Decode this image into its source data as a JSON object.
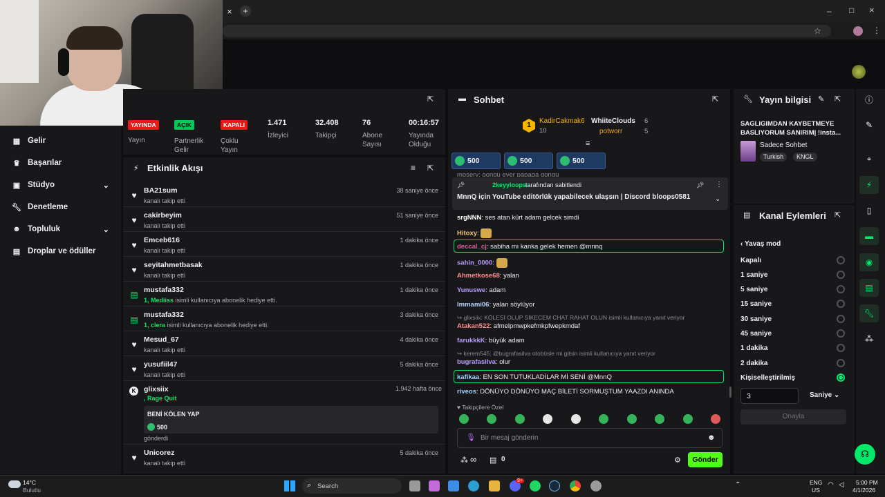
{
  "browser": {
    "tab_close": "×",
    "new_tab": "+",
    "win_min": "–",
    "win_max": "□",
    "win_close": "×"
  },
  "left_nav": {
    "items": [
      {
        "label": "Gelir",
        "icon": "chart-icon"
      },
      {
        "label": "Başarılar",
        "icon": "trophy-icon"
      },
      {
        "label": "Stüdyo",
        "icon": "studio-icon",
        "expandable": true
      },
      {
        "label": "Denetleme",
        "icon": "wrench-icon"
      },
      {
        "label": "Topluluk",
        "icon": "community-icon",
        "expandable": true
      },
      {
        "label": "Droplar ve ödüller",
        "icon": "gift-icon"
      }
    ]
  },
  "stats": {
    "tags": [
      "YAYINDA",
      "AÇIK",
      "KAPALI"
    ],
    "labels": [
      "Yayın",
      "Partnerlik\nGelir",
      "Çoklu\nYayın"
    ],
    "items": [
      {
        "value": "1.471",
        "label": "İzleyici"
      },
      {
        "value": "32.408",
        "label": "Takipçi"
      },
      {
        "value": "76",
        "label": "Abone\nSayısı"
      },
      {
        "value": "00:16:57",
        "label": "Yayında\nOlduğu"
      }
    ]
  },
  "activity": {
    "title": "Etkinlik Akışı",
    "rows": [
      {
        "name": "BA21sum",
        "sub": "kanalı takip etti",
        "time": "38 saniye önce",
        "type": "follow"
      },
      {
        "name": "cakirbeyim",
        "sub": "kanalı takip etti",
        "time": "51 saniye önce",
        "type": "follow"
      },
      {
        "name": "Emceb616",
        "sub": "kanalı takip etti",
        "time": "1 dakika önce",
        "type": "follow"
      },
      {
        "name": "seyitahmetbasak",
        "sub": "kanalı takip etti",
        "time": "1 dakika önce",
        "type": "follow"
      },
      {
        "name": "mustafa332",
        "sub_hl": "1, Mediiss",
        "sub": " isimli kullanıcıya abonelik hediye etti.",
        "time": "1 dakika önce",
        "type": "gift"
      },
      {
        "name": "mustafa332",
        "sub_hl": "1, clera",
        "sub": " isimli kullanıcıya abonelik hediye etti.",
        "time": "3 dakika önce",
        "type": "gift"
      },
      {
        "name": "Mesud_67",
        "sub": "kanalı takip etti",
        "time": "4 dakika önce",
        "type": "follow"
      },
      {
        "name": "yusufiil47",
        "sub": "kanalı takip etti",
        "time": "5 dakika önce",
        "type": "follow"
      }
    ],
    "redeem": {
      "name": "glixsiix",
      "sub_hl": ", Rage Quit",
      "time": "1.942 hafta önce",
      "message": "BENİ KÖLEN YAP",
      "points": "500",
      "footer": "gönderdi"
    },
    "last": {
      "name": "Unicorez",
      "sub": "kanalı takip etti",
      "time": "5 dakika önce"
    }
  },
  "chat": {
    "title": "Sohbet",
    "leaders": [
      {
        "rank": "1",
        "name": "KadirCakmak6",
        "count": "10"
      },
      {
        "name": "WhiiteClouds",
        "count": "6"
      },
      {
        "name": "potworr",
        "count": "5"
      }
    ],
    "points": [
      "500",
      "500",
      "500"
    ],
    "partial": "moserv: gongu eyer papaga gongu",
    "pinned": {
      "by": "2keyyloops",
      "by_suffix": "tarafından sabitlendi",
      "text": "MnnQ için YouTube editörlük yapabilecek ulaşsın | Discord bloops0581"
    },
    "messages": [
      {
        "user": "srgNNN",
        "text": "ses atan kürt adam gelcek simdi",
        "color": "#ffffff"
      },
      {
        "user": "Hitoxy",
        "text": "",
        "color": "#f2c97d",
        "emote": true
      },
      {
        "user": "deccal_cj",
        "text": "sabiha mı kanka gelek hemen @mnnq",
        "color": "#e05a9c",
        "hl": true
      },
      {
        "user": "sahin_0000",
        "text": "",
        "color": "#b79dff",
        "emote": true
      },
      {
        "user": "Ahmetkose68",
        "text": "yalan",
        "color": "#ff8f8f"
      },
      {
        "user": "Yunuswe",
        "text": "adam",
        "color": "#b79dff"
      },
      {
        "user": "lmmami06",
        "text": "yalan söylüyor",
        "color": "#b9d4ff"
      },
      {
        "reply": "glixsiix: KÖLESİ OLUP SİKECEM CHAT RAHAT OLUN isimli kullanıcıya yanıt veriyor"
      },
      {
        "user": "Atakan522",
        "text": "afmelpmwpkefmkpfwepkmdaf",
        "color": "#ff8f8f"
      },
      {
        "user": "farukkkK",
        "text": "büyük adam",
        "color": "#b79dff"
      },
      {
        "reply": "kerem545: @bugrafasilva otobüsle mi gitsin isimli kullanıcıya yanıt veriyor"
      },
      {
        "user": "bugrafasilva",
        "text": "olur",
        "color": "#b79dff"
      },
      {
        "user": "kafikaa",
        "text": "EN SON TUTUKLADİLAR Mİ SENİ @MnnQ",
        "color": "#9dd3ff",
        "hl": true
      },
      {
        "user": "riveos",
        "text": "DÖNÜYO DÖNÜYO MAÇ BİLETİ SORMUŞTUM YAAZDI ANINDA",
        "color": "#9dd3ff"
      }
    ],
    "followers_only": "Takipçilere Özel",
    "input_placeholder": "Bir mesaj gönderin",
    "infinity": "∞",
    "zero": "0",
    "send": "Gönder"
  },
  "stream_info": {
    "title": "Yayın bilgisi",
    "stream_title": "SAGLIGIMDAN KAYBETMEYE BASLIYORUM SANIRIM| !insta...",
    "category": "Sadece Sohbet",
    "tags": [
      "Turkish",
      "KNGL"
    ]
  },
  "channel_actions": {
    "title": "Kanal Eylemleri",
    "slow_mode": "Yavaş mod",
    "options": [
      "Kapalı",
      "1 saniye",
      "5 saniye",
      "15 saniye",
      "30 saniye",
      "45 saniye",
      "1 dakika",
      "2 dakika",
      "Kişiselleştirilmiş"
    ],
    "selected_index": 8,
    "custom_value": "3",
    "unit": "Saniye",
    "apply": "Onayla"
  },
  "taskbar": {
    "weather_temp": "14°C",
    "weather_text": "Bulutlu",
    "search": "Search",
    "lang": "ENG",
    "region": "US",
    "time": "5:00 PM",
    "date": "4/1/2026",
    "badge": "9+"
  },
  "colors": {
    "accent": "#00e96b",
    "live_red": "#e91916",
    "panel": "#18181b",
    "bg": "#0e0e10"
  }
}
